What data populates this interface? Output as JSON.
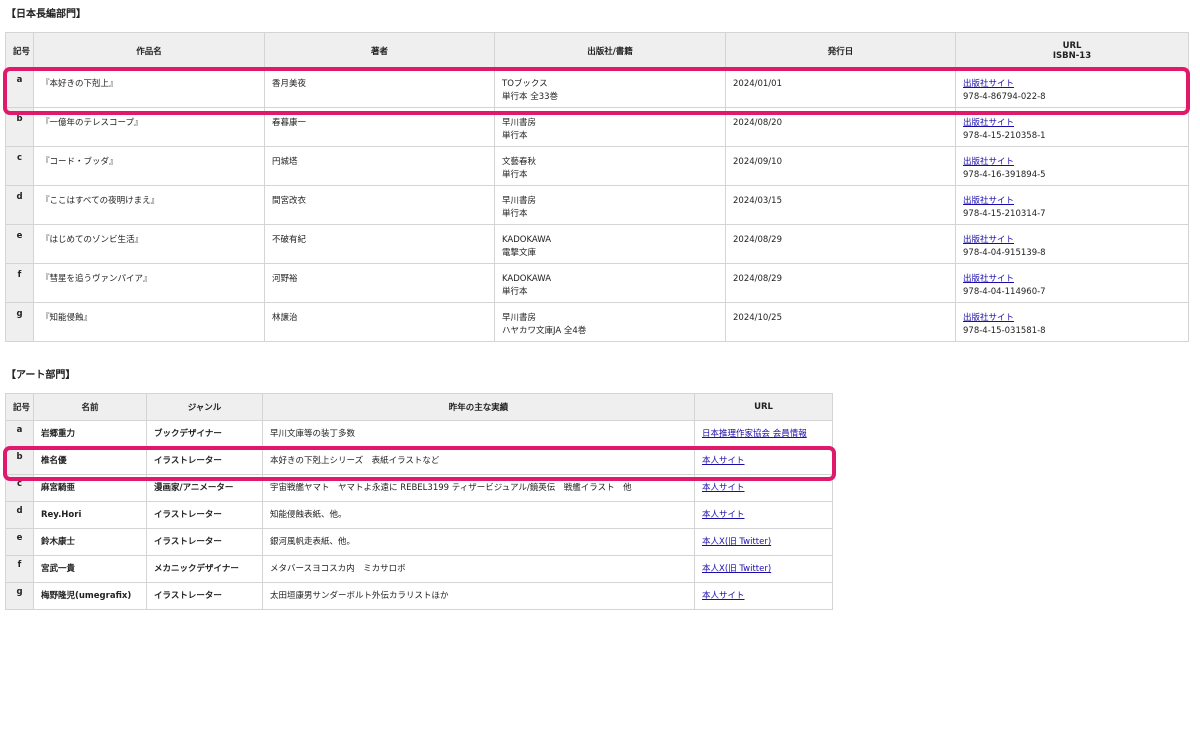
{
  "novel_section": {
    "title": "【日本長編部門】",
    "headers": {
      "code": "記号",
      "work": "作品名",
      "author": "著者",
      "publisher": "出版社/書籍",
      "date": "発行日",
      "url_line1": "URL",
      "url_line2": "ISBN-13"
    },
    "rows": [
      {
        "code": "a",
        "work": "『本好きの下剋上』",
        "author": "香月美夜",
        "publisher1": "TOブックス",
        "publisher2": "単行本 全33巻",
        "date": "2024/01/01",
        "link": "出版社サイト",
        "isbn": "978-4-86794-022-8"
      },
      {
        "code": "b",
        "work": "『一億年のテレスコープ』",
        "author": "春暮康一",
        "publisher1": "早川書房",
        "publisher2": "単行本",
        "date": "2024/08/20",
        "link": "出版社サイト",
        "isbn": "978-4-15-210358-1"
      },
      {
        "code": "c",
        "work": "『コード・ブッダ』",
        "author": "円城塔",
        "publisher1": "文藝春秋",
        "publisher2": "単行本",
        "date": "2024/09/10",
        "link": "出版社サイト",
        "isbn": "978-4-16-391894-5"
      },
      {
        "code": "d",
        "work": "『ここはすべての夜明けまえ』",
        "author": "間宮改衣",
        "publisher1": "早川書房",
        "publisher2": "単行本",
        "date": "2024/03/15",
        "link": "出版社サイト",
        "isbn": "978-4-15-210314-7"
      },
      {
        "code": "e",
        "work": "『はじめてのゾンビ生活』",
        "author": "不破有紀",
        "publisher1": "KADOKAWA",
        "publisher2": "電撃文庫",
        "date": "2024/08/29",
        "link": "出版社サイト",
        "isbn": "978-4-04-915139-8"
      },
      {
        "code": "f",
        "work": "『彗星を追うヴァンパイア』",
        "author": "河野裕",
        "publisher1": "KADOKAWA",
        "publisher2": "単行本",
        "date": "2024/08/29",
        "link": "出版社サイト",
        "isbn": "978-4-04-114960-7"
      },
      {
        "code": "g",
        "work": "『知能侵蝕』",
        "author": "林譲治",
        "publisher1": "早川書房",
        "publisher2": "ハヤカワ文庫JA 全4巻",
        "date": "2024/10/25",
        "link": "出版社サイト",
        "isbn": "978-4-15-031581-8"
      }
    ]
  },
  "art_section": {
    "title": "【アート部門】",
    "headers": {
      "code": "記号",
      "name": "名前",
      "genre": "ジャンル",
      "work": "昨年の主な実績",
      "url": "URL"
    },
    "rows": [
      {
        "code": "a",
        "name": "岩郷重力",
        "genre": "ブックデザイナー",
        "work": "早川文庫等の装丁多数",
        "link": "日本推理作家協会 会員情報"
      },
      {
        "code": "b",
        "name": "椎名優",
        "genre": "イラストレーター",
        "work": "本好きの下剋上シリーズ　表紙イラストなど",
        "link": "本人サイト"
      },
      {
        "code": "c",
        "name": "麻宮騎亜",
        "genre": "漫画家/アニメーター",
        "work": "宇宙戦艦ヤマト　ヤマトよ永遠に REBEL3199 ティザービジュアル/鏡英伝　戦艦イラスト　他",
        "link": "本人サイト"
      },
      {
        "code": "d",
        "name": "Rey.Hori",
        "genre": "イラストレーター",
        "work": "知能侵蝕表紙、他。",
        "link": "本人サイト"
      },
      {
        "code": "e",
        "name": "鈴木康士",
        "genre": "イラストレーター",
        "work": "銀河風帆走表紙、他。",
        "link": "本人X(旧 Twitter)"
      },
      {
        "code": "f",
        "name": "宮武一貴",
        "genre": "メカニックデザイナー",
        "work": "メタバースヨコスカ内　ミカサロボ",
        "link": "本人X(旧 Twitter)"
      },
      {
        "code": "g",
        "name": "梅野隆児(umegrafix)",
        "genre": "イラストレーター",
        "work": "太田垣康男サンダーボルト外伝カラリストほか",
        "link": "本人サイト"
      }
    ]
  },
  "colors": {
    "highlight": "#e0196b",
    "header_bg": "#efefef",
    "link": "#1a0dab"
  }
}
